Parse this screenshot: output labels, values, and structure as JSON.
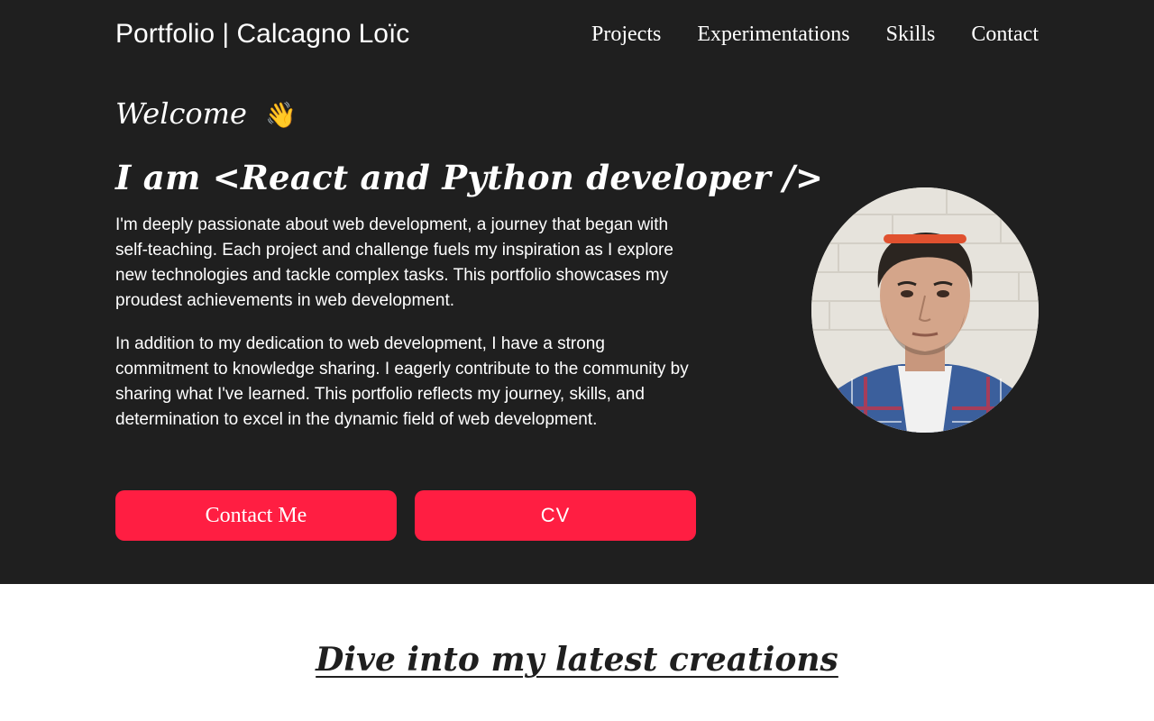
{
  "header": {
    "brand": "Portfolio | Calcagno Loïc",
    "nav": [
      "Projects",
      "Experimentations",
      "Skills",
      "Contact"
    ]
  },
  "hero": {
    "welcome": "Welcome",
    "wave_emoji": "👋",
    "headline": "I am <React and Python developer />",
    "paragraphs": [
      "I'm deeply passionate about web development, a journey that began with self-teaching. Each project and challenge fuels my inspiration as I explore new technologies and tackle complex tasks. This portfolio showcases my proudest achievements in web development.",
      "In addition to my dedication to web development, I have a strong commitment to knowledge sharing. I eagerly contribute to the community by sharing what I've learned. This portfolio reflects my journey, skills, and determination to excel in the dynamic field of web development."
    ],
    "contact_button": "Contact Me",
    "cv_button": "CV"
  },
  "projects_section": {
    "title": "Dive into my latest creations"
  },
  "colors": {
    "hero_background": "#1f1f1f",
    "accent": "#ff1e42",
    "text_light": "#ffffff",
    "text_dark": "#1f1f1f"
  },
  "icons": {
    "wave": "waving-hand-icon"
  }
}
